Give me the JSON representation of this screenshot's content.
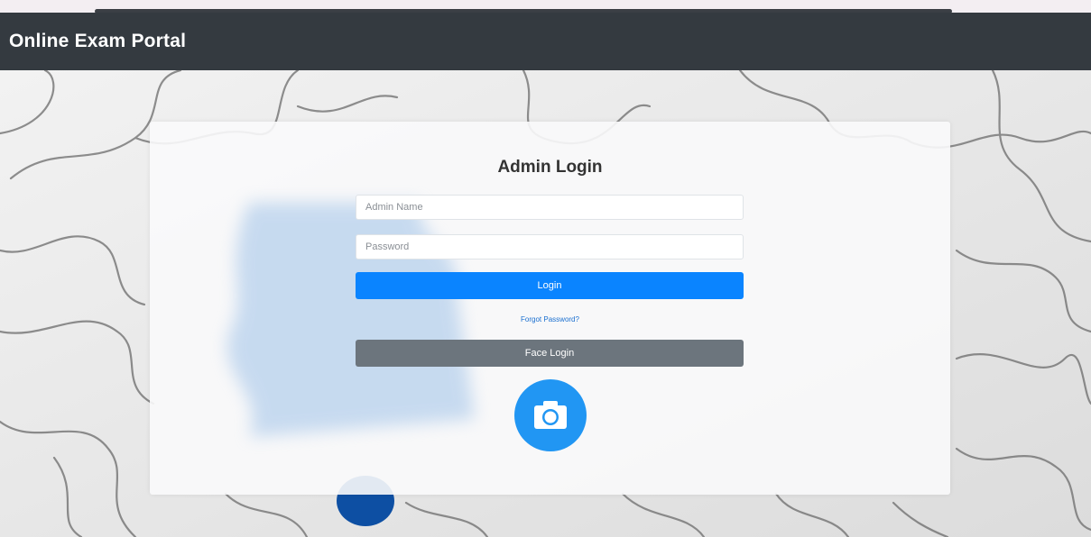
{
  "app": {
    "brand": "Online Exam Portal"
  },
  "login": {
    "title": "Admin Login",
    "admin_name_placeholder": "Admin Name",
    "password_placeholder": "Password",
    "login_button": "Login",
    "forgot_password": "Forgot Password?",
    "face_login_button": "Face Login",
    "camera_icon": "camera-icon"
  },
  "colors": {
    "navbar": "#343a40",
    "primary": "#0a84ff",
    "secondary": "#6c757d",
    "camera": "#2196f3",
    "link": "#1a6fd0"
  }
}
